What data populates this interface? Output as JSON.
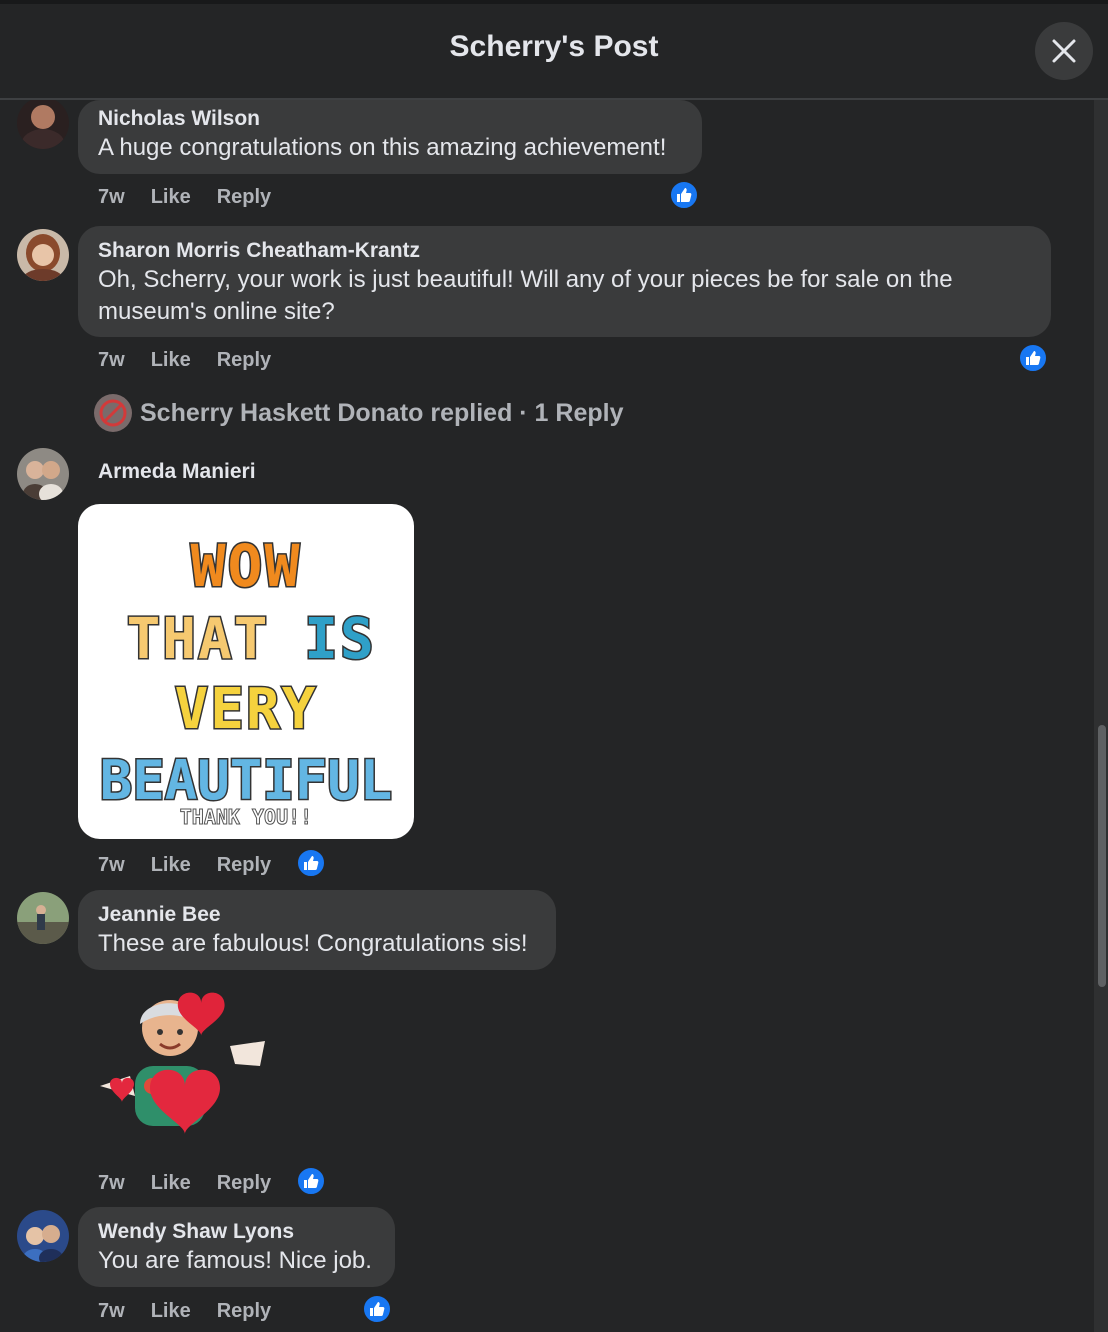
{
  "header": {
    "title": "Scherry's Post"
  },
  "comments": [
    {
      "author": "Nicholas Wilson",
      "text": "A huge congratulations on this amazing achievement!",
      "time": "7w",
      "like": "Like",
      "reply": "Reply",
      "reaction": "like"
    },
    {
      "author": "Sharon Morris Cheatham-Krantz",
      "text": "Oh, Scherry, your work is just beautiful! Will any of your pieces be for sale on the museum's online site?",
      "time": "7w",
      "like": "Like",
      "reply": "Reply",
      "reaction": "like"
    },
    {
      "author": "Armeda Manieri",
      "time": "7w",
      "like": "Like",
      "reply": "Reply",
      "reaction": "like",
      "gif": {
        "line1": "WOW",
        "line2a": "THAT",
        "line2b": "IS",
        "line3": "VERY",
        "line4": "BEAUTIFUL",
        "caption": "THANK YOU!!"
      }
    },
    {
      "author": "Jeannie Bee",
      "text": "These are fabulous! Congratulations sis!",
      "time": "7w",
      "like": "Like",
      "reply": "Reply",
      "reaction": "like"
    },
    {
      "author": "Wendy Shaw Lyons",
      "text": "You are famous! Nice job.",
      "time": "7w",
      "like": "Like",
      "reply": "Reply",
      "reaction": "like"
    }
  ],
  "reply_summary": {
    "text": "Scherry Haskett Donato replied · 1 Reply"
  },
  "colors": {
    "background": "#242526",
    "bubble": "#3a3b3c",
    "like_blue": "#1877f2",
    "muted_text": "#b0b3b8"
  },
  "icons": {
    "close": "close-icon",
    "reaction": "thumbs-up-icon"
  }
}
